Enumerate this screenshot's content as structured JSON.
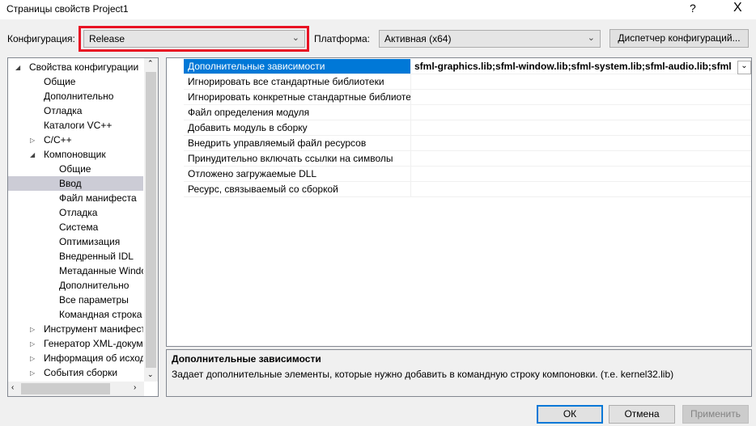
{
  "window": {
    "title": "Страницы свойств Project1",
    "help": "?",
    "close": "X"
  },
  "toolbar": {
    "config_label": "Конфигурация:",
    "config_value": "Release",
    "platform_label": "Платформа:",
    "platform_value": "Активная (x64)",
    "config_manager": "Диспетчер конфигураций..."
  },
  "tree": [
    {
      "label": "Свойства конфигурации",
      "level": 0,
      "toggle": "expanded"
    },
    {
      "label": "Общие",
      "level": 1
    },
    {
      "label": "Дополнительно",
      "level": 1
    },
    {
      "label": "Отладка",
      "level": 1
    },
    {
      "label": "Каталоги VC++",
      "level": 1
    },
    {
      "label": "C/C++",
      "level": 1,
      "toggle": "collapsed"
    },
    {
      "label": "Компоновщик",
      "level": 1,
      "toggle": "expanded"
    },
    {
      "label": "Общие",
      "level": 2
    },
    {
      "label": "Ввод",
      "level": 2,
      "selected": true
    },
    {
      "label": "Файл манифеста",
      "level": 2
    },
    {
      "label": "Отладка",
      "level": 2
    },
    {
      "label": "Система",
      "level": 2
    },
    {
      "label": "Оптимизация",
      "level": 2
    },
    {
      "label": "Внедренный IDL",
      "level": 2
    },
    {
      "label": "Метаданные Windows",
      "level": 2
    },
    {
      "label": "Дополнительно",
      "level": 2
    },
    {
      "label": "Все параметры",
      "level": 2
    },
    {
      "label": "Командная строка",
      "level": 2
    },
    {
      "label": "Инструмент манифеста",
      "level": 1,
      "toggle": "collapsed"
    },
    {
      "label": "Генератор XML-документов",
      "level": 1,
      "toggle": "collapsed"
    },
    {
      "label": "Информация об исходном коде",
      "level": 1,
      "toggle": "collapsed"
    },
    {
      "label": "События сборки",
      "level": 1,
      "toggle": "collapsed"
    }
  ],
  "properties": [
    {
      "name": "Дополнительные зависимости",
      "value": "sfml-graphics.lib;sfml-window.lib;sfml-system.lib;sfml-audio.lib;sfml-network.lib",
      "selected": true
    },
    {
      "name": "Игнорировать все стандартные библиотеки",
      "value": ""
    },
    {
      "name": "Игнорировать конкретные стандартные библиотеки",
      "value": ""
    },
    {
      "name": "Файл определения модуля",
      "value": ""
    },
    {
      "name": "Добавить модуль в сборку",
      "value": ""
    },
    {
      "name": "Внедрить управляемый файл ресурсов",
      "value": ""
    },
    {
      "name": "Принудительно включать ссылки на символы",
      "value": ""
    },
    {
      "name": "Отложено загружаемые DLL",
      "value": ""
    },
    {
      "name": "Ресурс, связываемый со сборкой",
      "value": ""
    }
  ],
  "description": {
    "title": "Дополнительные зависимости",
    "text": "Задает дополнительные элементы, которые нужно добавить в командную строку компоновки. (т.е. kernel32.lib)"
  },
  "buttons": {
    "ok": "ОК",
    "cancel": "Отмена",
    "apply": "Применить"
  },
  "colors": {
    "highlight_box": "#e81123",
    "selection": "#0078d7"
  }
}
